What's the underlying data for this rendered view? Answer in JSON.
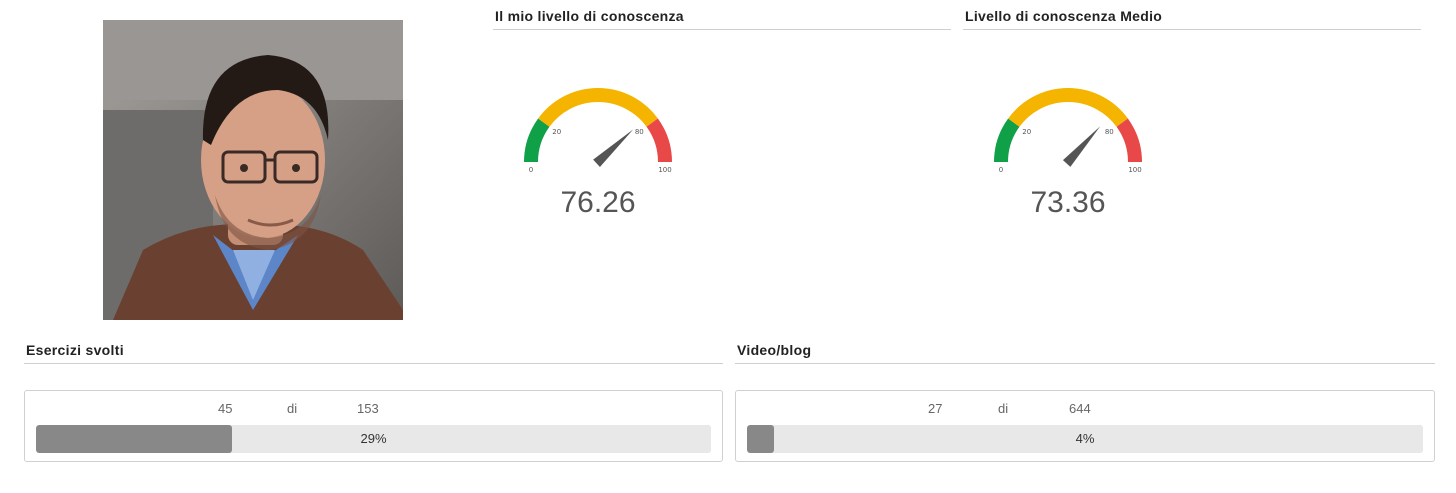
{
  "profile": {
    "photo_icon": "user-photo"
  },
  "gauges": [
    {
      "title": "Il mio livello di conoscenza",
      "value": 76.26,
      "value_text": "76.26",
      "ticks": [
        "0",
        "20",
        "80",
        "100"
      ],
      "colors": {
        "low": "#0fa048",
        "mid": "#f5b400",
        "high": "#e84848",
        "needle": "#555555"
      }
    },
    {
      "title": "Livello di conoscenza Medio",
      "value": 73.36,
      "value_text": "73.36",
      "ticks": [
        "0",
        "20",
        "80",
        "100"
      ],
      "colors": {
        "low": "#0fa048",
        "mid": "#f5b400",
        "high": "#e84848",
        "needle": "#555555"
      }
    }
  ],
  "progress": [
    {
      "title": "Esercizi svolti",
      "done": "45",
      "separator": "di",
      "total": "153",
      "percent": 29,
      "percent_text": "29%"
    },
    {
      "title": "Video/blog",
      "done": "27",
      "separator": "di",
      "total": "644",
      "percent": 4,
      "percent_text": "4%"
    }
  ]
}
